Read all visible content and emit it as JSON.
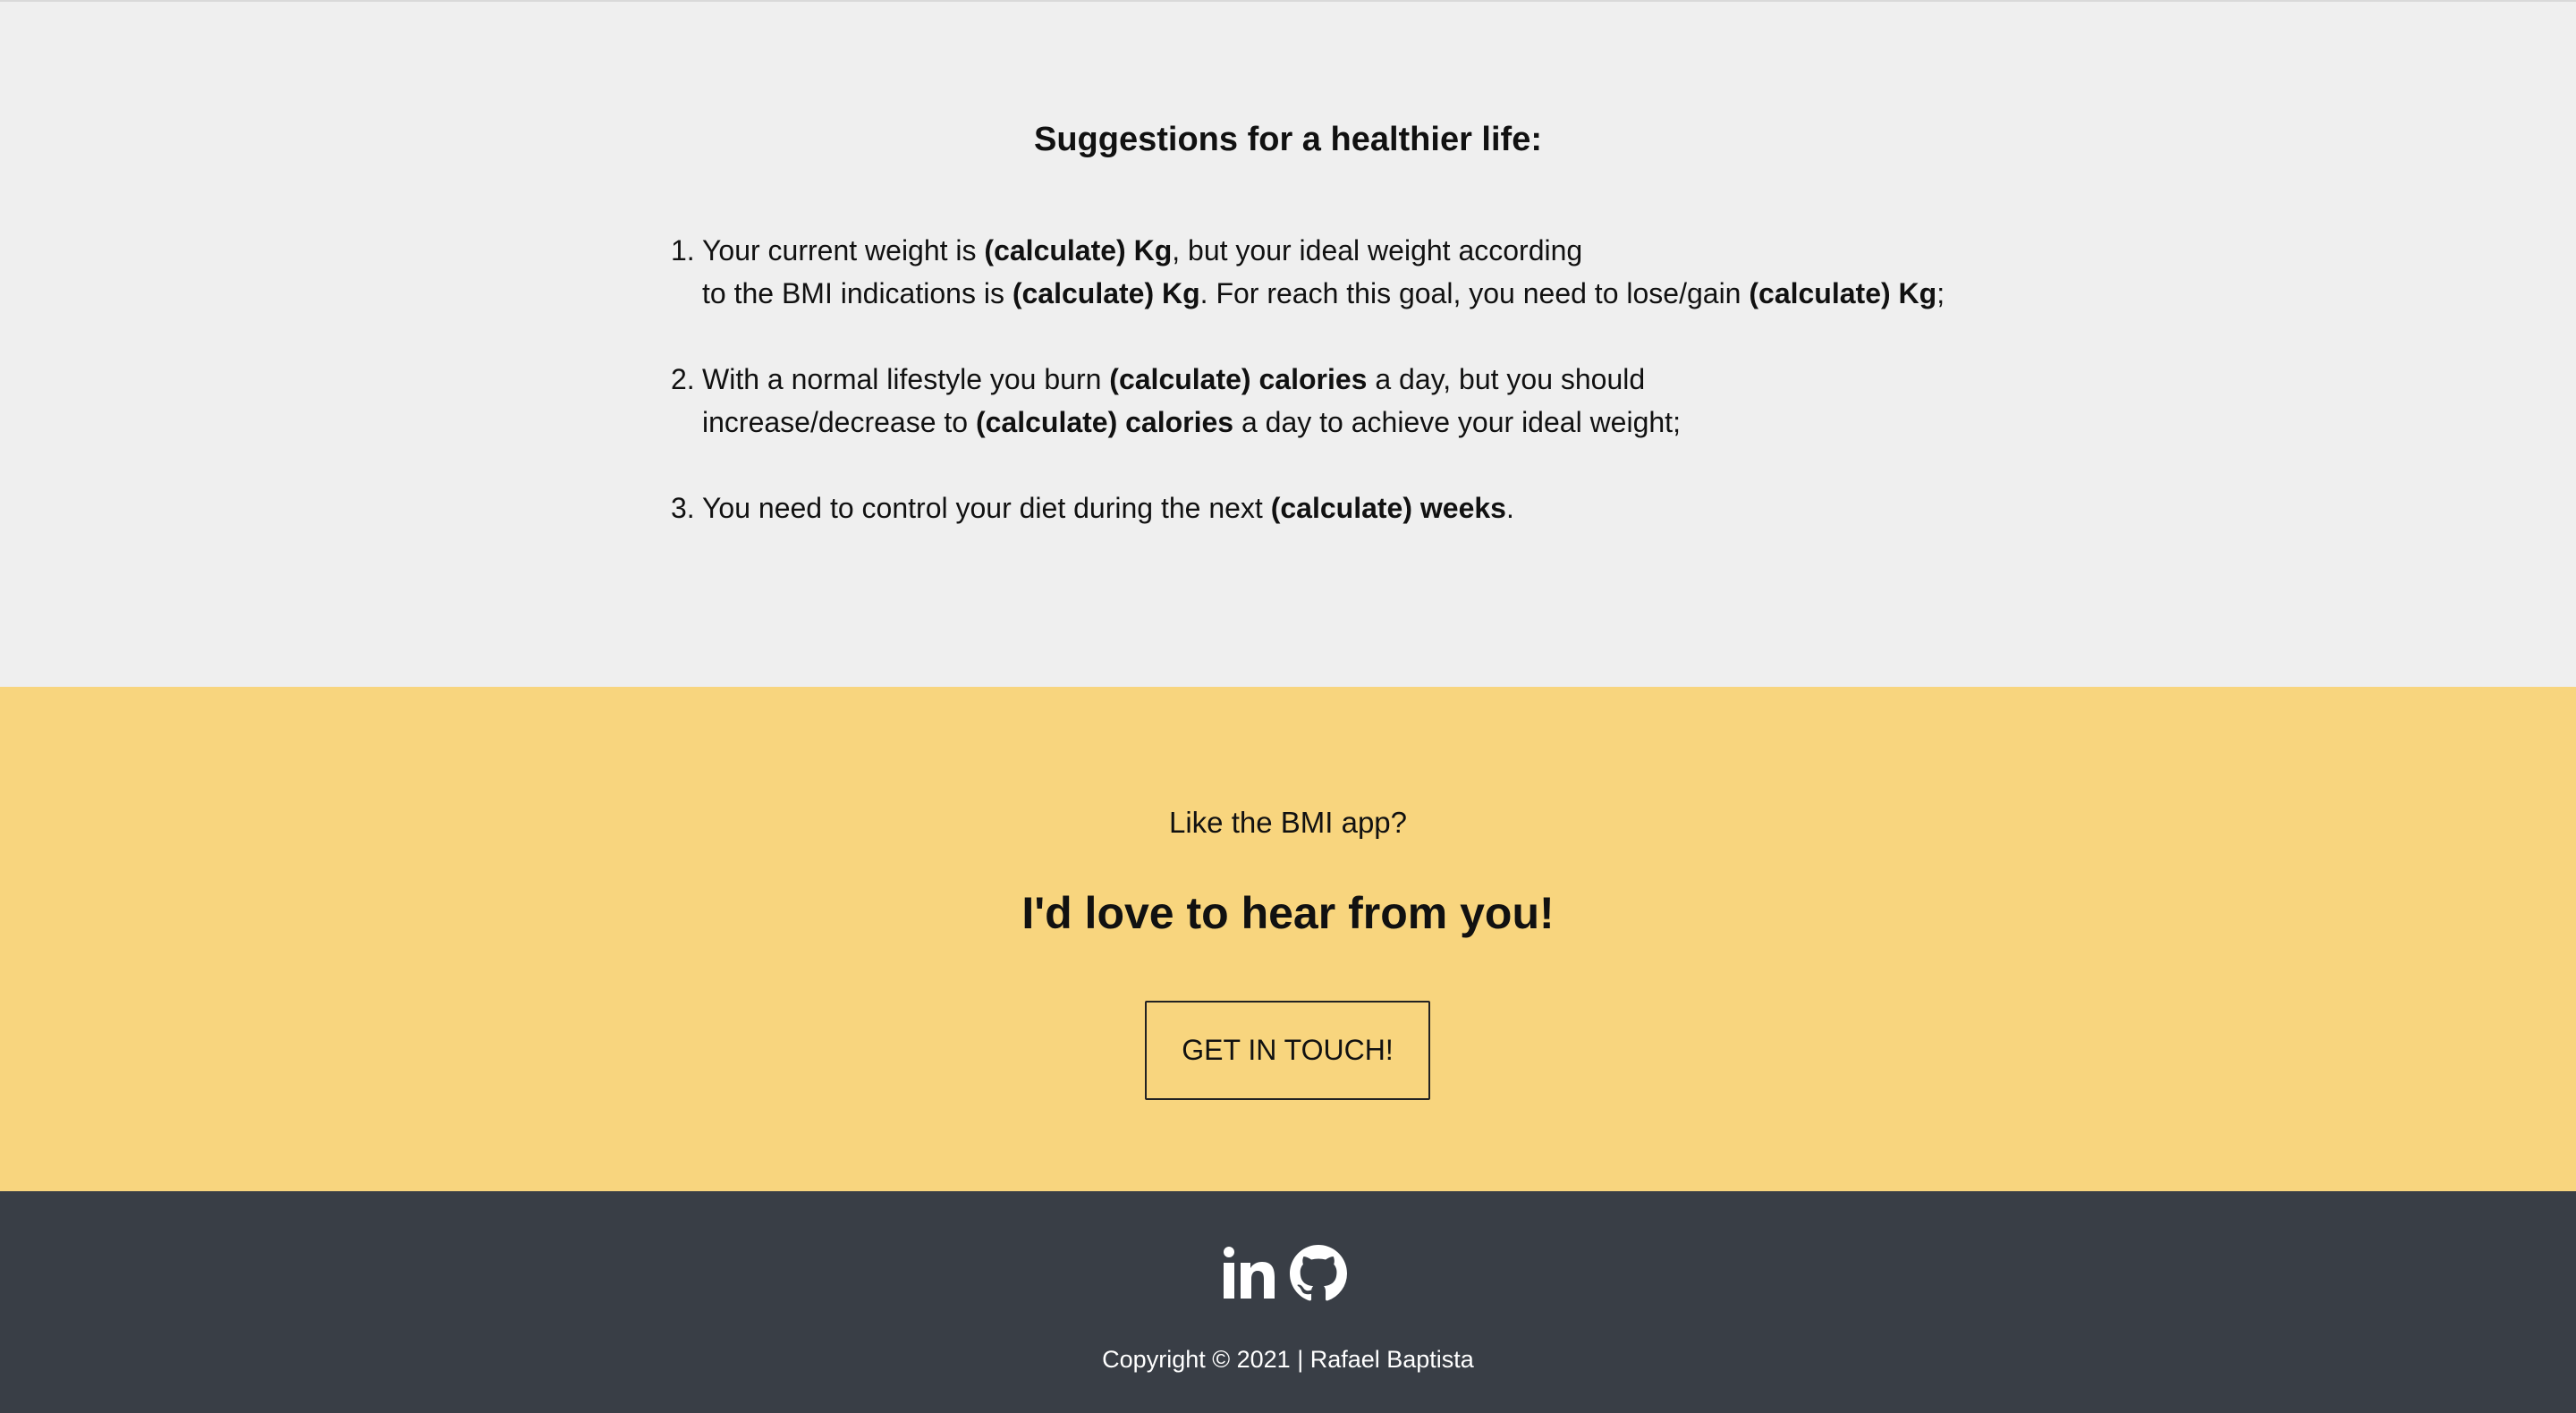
{
  "suggestions": {
    "title": "Suggestions for a healthier life:",
    "items": [
      {
        "number": "1.",
        "parts": [
          {
            "text": "Your current weight is ",
            "bold": false
          },
          {
            "text": "(calculate) Kg",
            "bold": true
          },
          {
            "text": ", but your ideal weight according",
            "bold": false
          },
          {
            "br": true
          },
          {
            "text": "to the BMI indications is ",
            "bold": false
          },
          {
            "text": "(calculate) Kg",
            "bold": true
          },
          {
            "text": ". For reach this goal, you need to lose/gain ",
            "bold": false
          },
          {
            "text": "(calculate) Kg",
            "bold": true
          },
          {
            "text": ";",
            "bold": false
          }
        ]
      },
      {
        "number": "2.",
        "parts": [
          {
            "text": "With a normal lifestyle you burn ",
            "bold": false
          },
          {
            "text": "(calculate) calories",
            "bold": true
          },
          {
            "text": " a day, but you should",
            "bold": false
          },
          {
            "br": true
          },
          {
            "text": "increase/decrease to ",
            "bold": false
          },
          {
            "text": "(calculate) calories",
            "bold": true
          },
          {
            "text": " a day to achieve your ideal weight;",
            "bold": false
          }
        ]
      },
      {
        "number": "3.",
        "parts": [
          {
            "text": "You need to control your diet during the next ",
            "bold": false
          },
          {
            "text": "(calculate) weeks",
            "bold": true
          },
          {
            "text": ".",
            "bold": false
          }
        ]
      }
    ]
  },
  "cta": {
    "question": "Like the BMI app?",
    "heading": "I'd love to hear from you!",
    "button_label": "GET IN TOUCH!"
  },
  "footer": {
    "social": [
      {
        "icon": "linkedin-icon",
        "label": "LinkedIn"
      },
      {
        "icon": "github-icon",
        "label": "GitHub"
      }
    ],
    "copyright": "Copyright © 2021 | Rafael Baptista"
  },
  "colors": {
    "suggestions_bg": "#efefef",
    "cta_bg": "#f8d57e",
    "footer_bg": "#393e46",
    "text": "#111111",
    "footer_text": "#ffffff"
  }
}
